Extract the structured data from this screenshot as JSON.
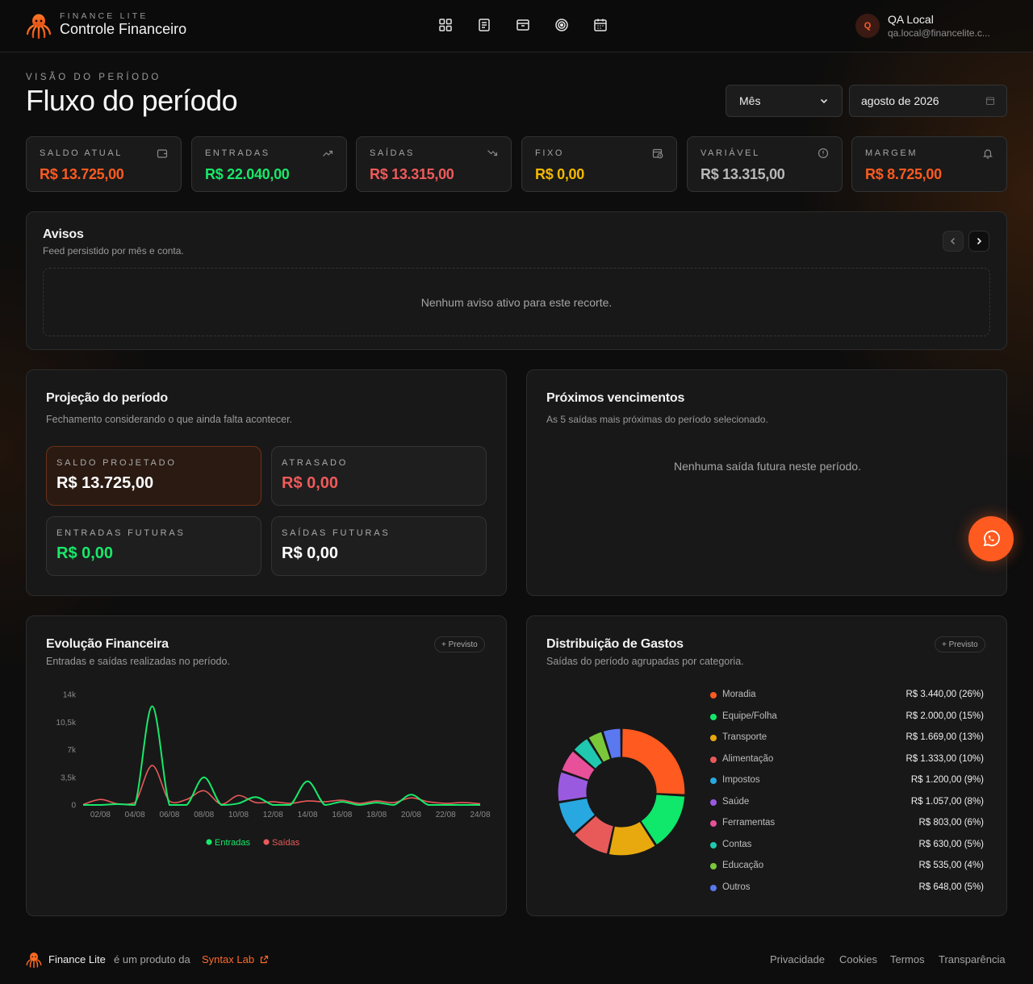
{
  "header": {
    "brand_small": "FINANCE LITE",
    "brand_title": "Controle Financeiro",
    "nav": [
      "dashboard-icon",
      "receipt-icon",
      "archive-icon",
      "target-icon",
      "calendar-icon"
    ],
    "user": {
      "initial": "Q",
      "name": "QA Local",
      "email": "qa.local@financelite.c..."
    }
  },
  "page": {
    "kicker": "VISÃO DO PERÍODO",
    "title": "Fluxo do período",
    "period_select": "Mês",
    "date_value": "agosto de 2026"
  },
  "kpis": [
    {
      "label": "SALDO ATUAL",
      "value": "R$ 13.725,00",
      "color": "#ff5a1f",
      "icon": "wallet-icon"
    },
    {
      "label": "ENTRADAS",
      "value": "R$ 22.040,00",
      "color": "#18e86a",
      "icon": "trend-up-icon"
    },
    {
      "label": "SAÍDAS",
      "value": "R$ 13.315,00",
      "color": "#ef5a5a",
      "icon": "trend-down-icon"
    },
    {
      "label": "FIXO",
      "value": "R$ 0,00",
      "color": "#f5b800",
      "icon": "calendar-clock-icon"
    },
    {
      "label": "VARIÁVEL",
      "value": "R$ 13.315,00",
      "color": "#b8b8b8",
      "icon": "alert-circle-icon"
    },
    {
      "label": "MARGEM",
      "value": "R$ 8.725,00",
      "color": "#ff5a1f",
      "icon": "bell-icon"
    }
  ],
  "avisos": {
    "title": "Avisos",
    "subtitle": "Feed persistido por mês e conta.",
    "empty": "Nenhum aviso ativo para este recorte."
  },
  "projecao": {
    "title": "Projeção do período",
    "subtitle": "Fechamento considerando o que ainda falta acontecer.",
    "tiles": [
      {
        "label": "SALDO PROJETADO",
        "value": "R$ 13.725,00",
        "color": "#ffffff"
      },
      {
        "label": "ATRASADO",
        "value": "R$ 0,00",
        "color": "#ef5a5a"
      },
      {
        "label": "ENTRADAS FUTURAS",
        "value": "R$ 0,00",
        "color": "#18e86a"
      },
      {
        "label": "SAÍDAS FUTURAS",
        "value": "R$ 0,00",
        "color": "#ffffff"
      }
    ]
  },
  "vencimentos": {
    "title": "Próximos vencimentos",
    "subtitle": "As 5 saídas mais próximas do período selecionado.",
    "empty": "Nenhuma saída futura neste período."
  },
  "evolucao": {
    "title": "Evolução Financeira",
    "subtitle": "Entradas e saídas realizadas no período.",
    "pill": "+ Previsto"
  },
  "distribuicao": {
    "title": "Distribuição de Gastos",
    "subtitle": "Saídas do período agrupadas por categoria.",
    "pill": "+ Previsto"
  },
  "chart_data": [
    {
      "type": "line",
      "x": [
        "01/08",
        "02/08",
        "03/08",
        "04/08",
        "05/08",
        "06/08",
        "07/08",
        "08/08",
        "09/08",
        "10/08",
        "11/08",
        "12/08",
        "13/08",
        "14/08",
        "15/08",
        "16/08",
        "17/08",
        "18/08",
        "19/08",
        "20/08",
        "21/08",
        "22/08",
        "23/08",
        "24/08"
      ],
      "x_tick_labels": [
        "02/08",
        "04/08",
        "06/08",
        "08/08",
        "10/08",
        "12/08",
        "14/08",
        "16/08",
        "18/08",
        "20/08",
        "22/08",
        "24/08"
      ],
      "y_tick_labels": [
        "0",
        "3,5k",
        "7k",
        "10,5k",
        "14k"
      ],
      "ylim": [
        0,
        14000
      ],
      "series": [
        {
          "name": "Entradas",
          "color": "#18e86a",
          "values": [
            0,
            0,
            100,
            0,
            12500,
            0,
            0,
            3500,
            0,
            200,
            1000,
            0,
            0,
            3000,
            0,
            400,
            0,
            300,
            0,
            1300,
            0,
            0,
            0,
            0
          ]
        },
        {
          "name": "Saídas",
          "color": "#e85a5a",
          "values": [
            50,
            700,
            150,
            300,
            5000,
            500,
            700,
            1800,
            100,
            1200,
            300,
            400,
            200,
            500,
            400,
            600,
            200,
            500,
            300,
            900,
            400,
            200,
            300,
            150
          ]
        }
      ],
      "legend_position": "bottom",
      "grid": false
    },
    {
      "type": "pie",
      "donut": true,
      "legend_position": "right",
      "slices": [
        {
          "label": "Moradia",
          "value": 3440.0,
          "display": "R$ 3.440,00 (26%)",
          "color": "#ff5a1f"
        },
        {
          "label": "Equipe/Folha",
          "value": 2000.0,
          "display": "R$ 2.000,00 (15%)",
          "color": "#0fe86a"
        },
        {
          "label": "Transporte",
          "value": 1669.0,
          "display": "R$ 1.669,00 (13%)",
          "color": "#e8a90e"
        },
        {
          "label": "Alimentação",
          "value": 1333.0,
          "display": "R$ 1.333,00 (10%)",
          "color": "#e85a5a"
        },
        {
          "label": "Impostos",
          "value": 1200.0,
          "display": "R$ 1.200,00 (9%)",
          "color": "#28a8e0"
        },
        {
          "label": "Saúde",
          "value": 1057.0,
          "display": "R$ 1.057,00 (8%)",
          "color": "#9a5ae0"
        },
        {
          "label": "Ferramentas",
          "value": 803.0,
          "display": "R$ 803,00 (6%)",
          "color": "#e8509a"
        },
        {
          "label": "Contas",
          "value": 630.0,
          "display": "R$ 630,00 (5%)",
          "color": "#20c8b0"
        },
        {
          "label": "Educação",
          "value": 535.0,
          "display": "R$ 535,00 (4%)",
          "color": "#7ac83a"
        },
        {
          "label": "Outros",
          "value": 648.0,
          "display": "R$ 648,00 (5%)",
          "color": "#5a78f0"
        }
      ]
    }
  ],
  "fab": {
    "icon": "whatsapp-icon"
  },
  "footer": {
    "brand": "Finance Lite",
    "text": "é um produto da",
    "link": "Syntax Lab",
    "nav": [
      "Privacidade",
      "Cookies",
      "Termos",
      "Transparência"
    ]
  }
}
